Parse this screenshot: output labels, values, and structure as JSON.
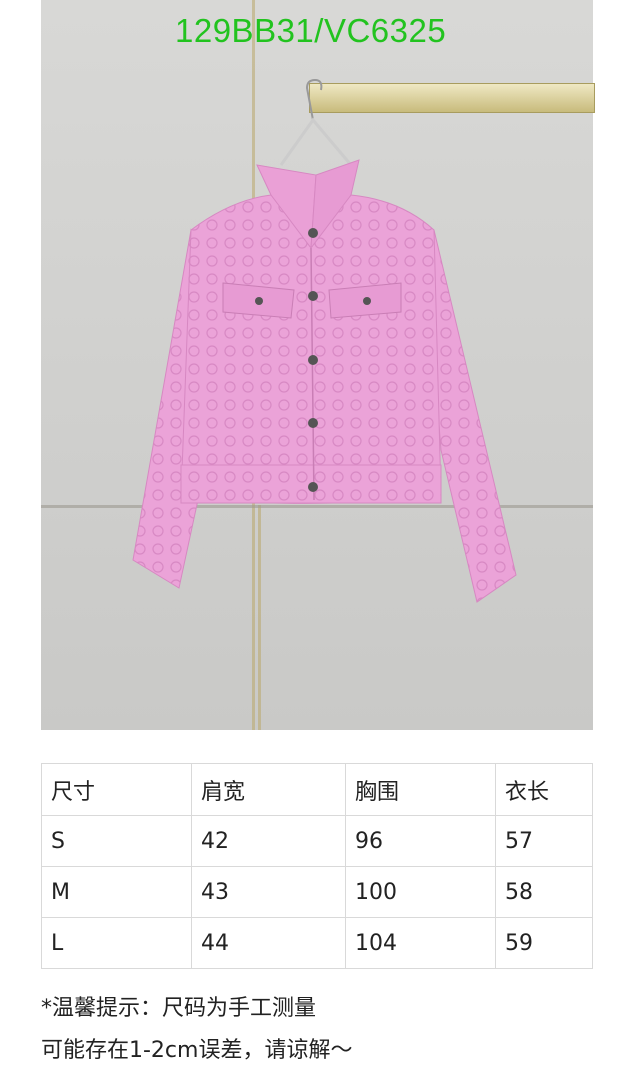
{
  "product_code": "129BB31/VC6325",
  "size_table": {
    "headers": [
      "尺寸",
      "肩宽",
      "胸围",
      "衣长"
    ],
    "rows": [
      [
        "S",
        "42",
        "96",
        "57"
      ],
      [
        "M",
        "43",
        "100",
        "58"
      ],
      [
        "L",
        "44",
        "104",
        "59"
      ]
    ]
  },
  "notes": {
    "line1": "*温馨提示：尺码为手工测量",
    "line2": "可能存在1-2cm误差，请谅解～"
  },
  "colors": {
    "label": "#22c31f",
    "jacket": "#eaa0d6"
  }
}
